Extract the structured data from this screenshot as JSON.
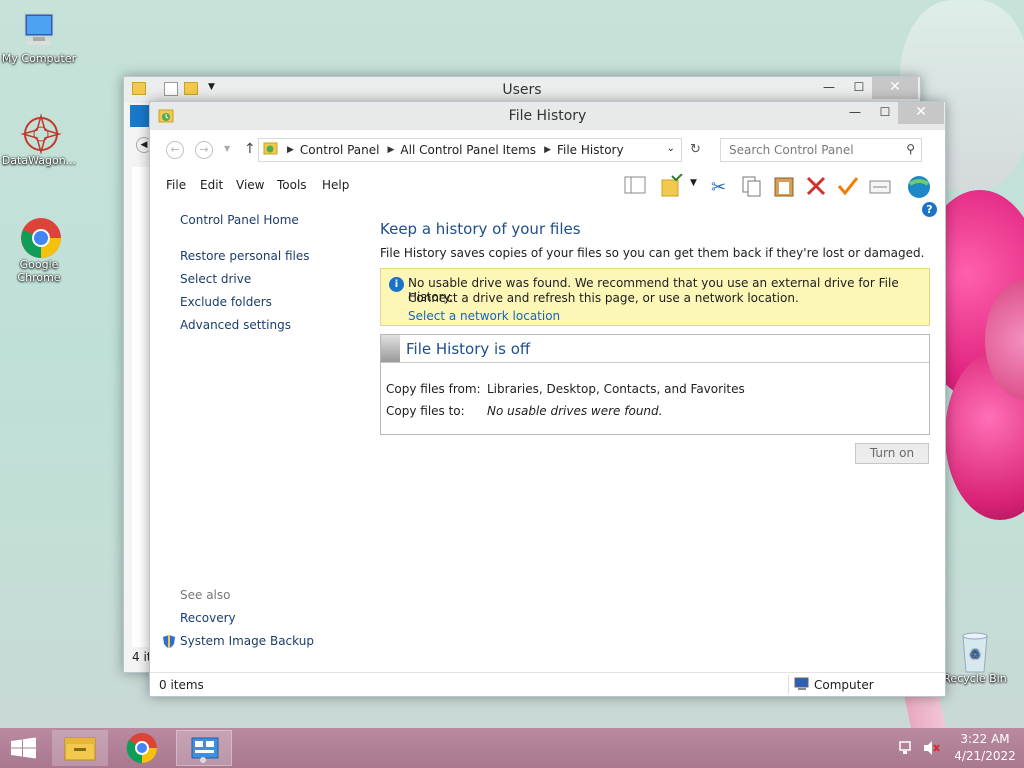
{
  "desktop": {
    "icons": [
      {
        "label": "My Computer"
      },
      {
        "label": "DataWagon..."
      },
      {
        "label": "Google Chrome"
      },
      {
        "label": "Recycle Bin"
      }
    ]
  },
  "users_window": {
    "title": "Users",
    "status": "4 it"
  },
  "file_history_window": {
    "title": "File History",
    "breadcrumbs": [
      "Control Panel",
      "All Control Panel Items",
      "File History"
    ],
    "search_placeholder": "Search Control Panel",
    "menu": [
      "File",
      "Edit",
      "View",
      "Tools",
      "Help"
    ],
    "sidebar": {
      "home": "Control Panel Home",
      "links": [
        "Restore personal files",
        "Select drive",
        "Exclude folders",
        "Advanced settings"
      ],
      "see_also": "See also",
      "see_also_links": [
        "Recovery",
        "System Image Backup"
      ]
    },
    "main": {
      "heading": "Keep a history of your files",
      "description": "File History saves copies of your files so you can get them back if they're lost or damaged.",
      "info_line1": "No usable drive was found. We recommend that you use an external drive for File History.",
      "info_line2": "Connect a drive and refresh this page, or use a network location.",
      "info_link": "Select a network location",
      "status_title": "File History is off",
      "copy_from_label": "Copy files from:",
      "copy_from_value": "Libraries, Desktop, Contacts, and Favorites",
      "copy_to_label": "Copy files to:",
      "copy_to_value": "No usable drives were found.",
      "turn_on": "Turn on"
    },
    "statusbar": {
      "items": "0 items",
      "location": "Computer"
    }
  },
  "taskbar": {
    "time": "3:22 AM",
    "date": "4/21/2022"
  },
  "colors": {
    "heading_blue": "#1e4e8c",
    "info_bg": "#fcf7b6",
    "taskbar": "#b07f95"
  }
}
